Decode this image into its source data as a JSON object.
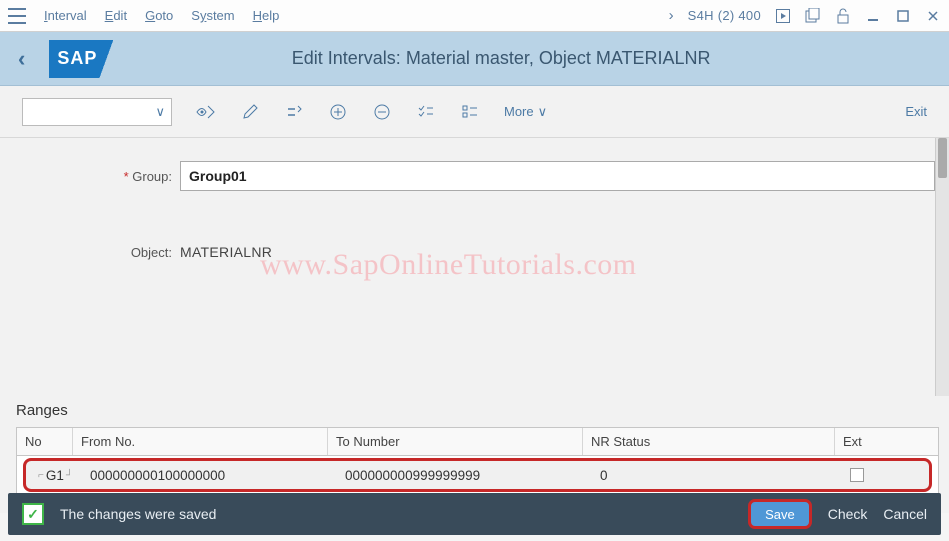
{
  "menubar": {
    "items": [
      "Interval",
      "Edit",
      "Goto",
      "System",
      "Help"
    ],
    "system_id": "S4H (2) 400"
  },
  "titlebar": {
    "logo_text": "SAP",
    "title": "Edit Intervals: Material master, Object MATERIALNR"
  },
  "toolbar": {
    "more_label": "More",
    "exit_label": "Exit"
  },
  "form": {
    "group_label": "Group:",
    "group_value": "Group01",
    "object_label": "Object:",
    "object_value": "MATERIALNR"
  },
  "watermark": "www.SapOnlineTutorials.com",
  "ranges": {
    "section_title": "Ranges",
    "columns": {
      "no": "No",
      "from": "From No.",
      "to": "To Number",
      "status": "NR Status",
      "ext": "Ext"
    },
    "rows": [
      {
        "no": "G1",
        "from": "000000000100000000",
        "to": "000000000999999999",
        "status": "0",
        "ext": false
      }
    ]
  },
  "statusbar": {
    "message": "The changes were saved",
    "save": "Save",
    "check": "Check",
    "cancel": "Cancel"
  }
}
